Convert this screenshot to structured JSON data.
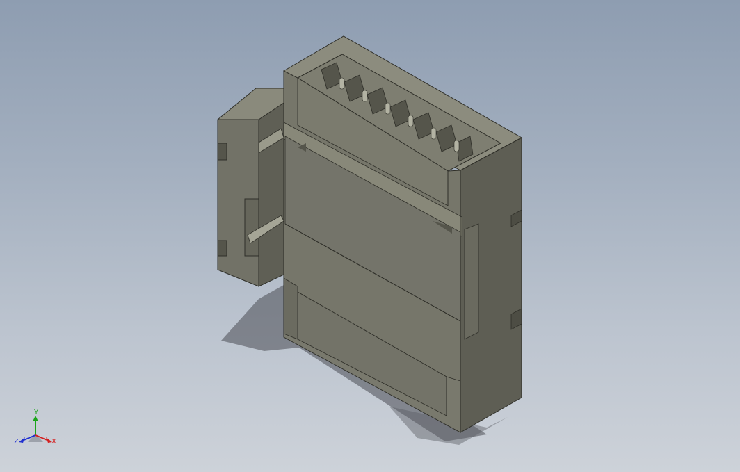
{
  "scene": {
    "background_top": "#8e9db1",
    "background_bottom": "#cdd2d9",
    "part_color": "#76766a",
    "part_dark": "#55554b",
    "part_light": "#8a8a7c"
  },
  "triad": {
    "x_label": "X",
    "y_label": "Y",
    "z_label": "Z",
    "x_color": "#d42020",
    "y_color": "#1aa51a",
    "z_color": "#2030d0"
  }
}
